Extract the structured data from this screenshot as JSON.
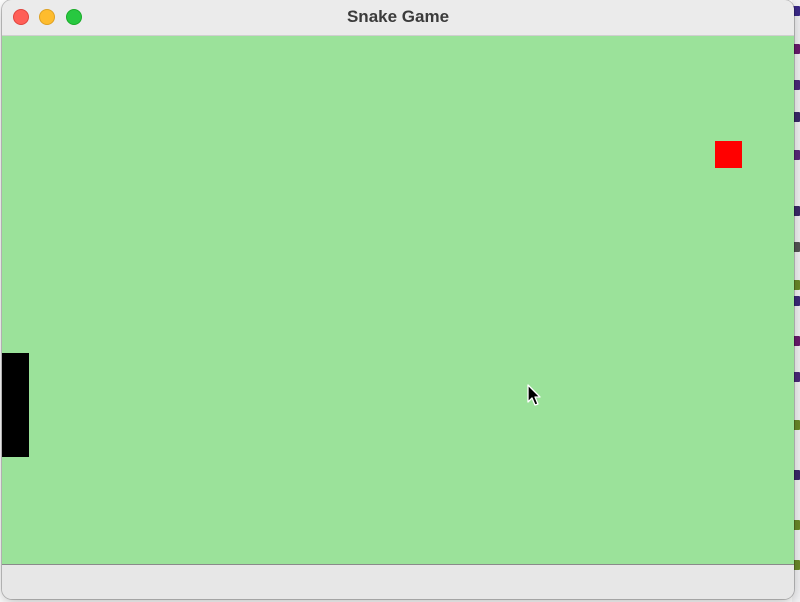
{
  "window": {
    "title": "Snake Game",
    "controls": [
      "close",
      "minimize",
      "maximize"
    ]
  },
  "game": {
    "board_color": "#9be29a",
    "snake_color": "#000000",
    "food_color": "#ff0000",
    "snake_length": 4,
    "snake_direction": "vertical"
  },
  "icons": {
    "close": "close-icon",
    "minimize": "minimize-icon",
    "maximize": "maximize-icon",
    "pointer": "mouse-pointer-icon"
  }
}
